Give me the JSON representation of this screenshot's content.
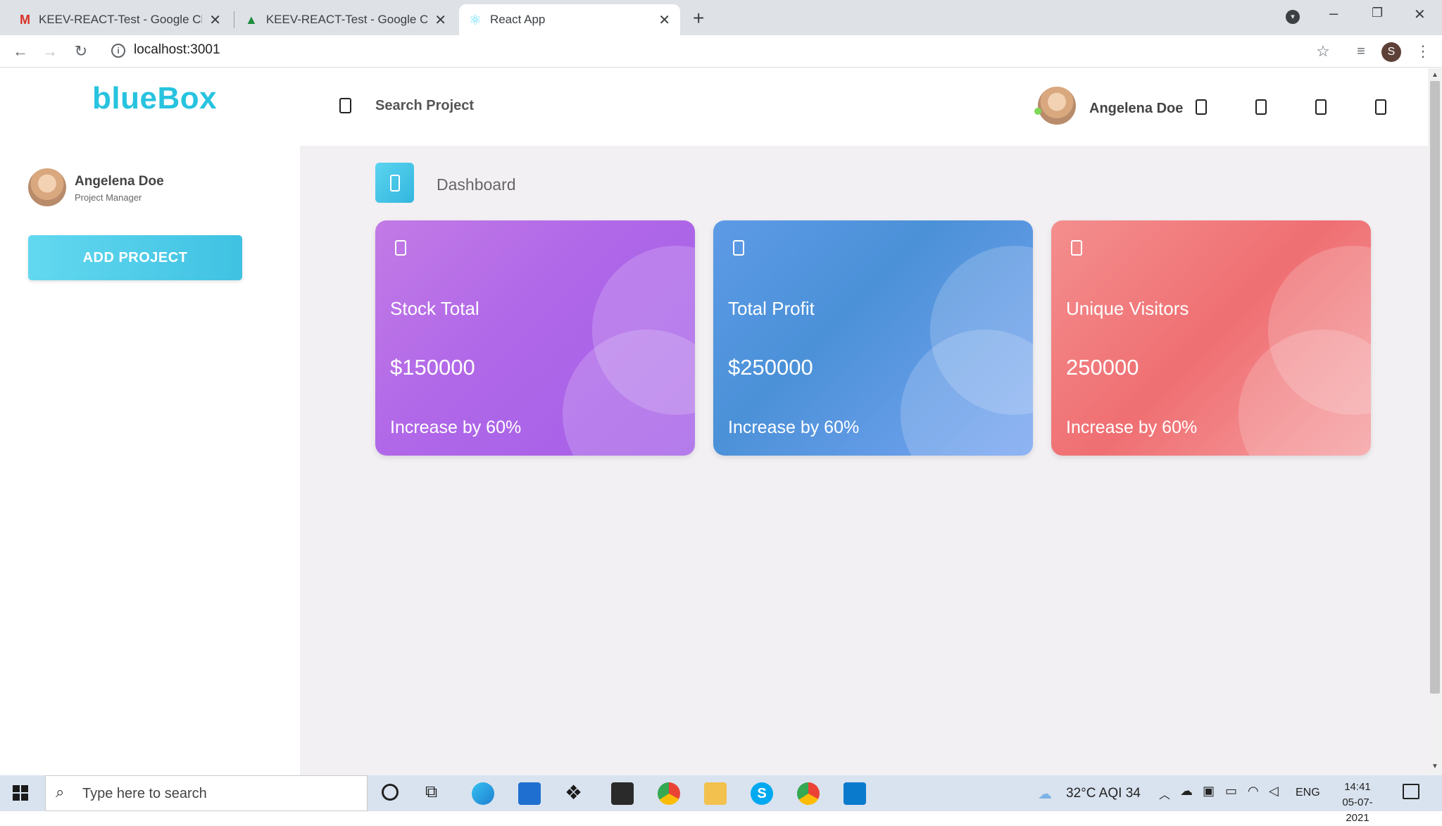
{
  "browser": {
    "tabs": [
      {
        "title": "KEEV-REACT-Test - Google Chrome",
        "icon": "gmail-icon"
      },
      {
        "title": "KEEV-REACT-Test - Google Chrome",
        "icon": "drive-icon"
      },
      {
        "title": "React App",
        "icon": "react-icon"
      }
    ],
    "url": "localhost:3001",
    "profile_initial": "S"
  },
  "header": {
    "logo": "blueBox",
    "search_label": "Search Project",
    "user_name": "Angelena Doe"
  },
  "sidebar": {
    "user_name": "Angelena Doe",
    "user_role": "Project Manager",
    "add_project_label": "ADD PROJECT"
  },
  "main": {
    "title": "Dashboard",
    "cards": [
      {
        "title": "Stock Total",
        "value": "$150000",
        "subtitle": "Increase by 60%",
        "color": "#b067e8"
      },
      {
        "title": "Total Profit",
        "value": "$250000",
        "subtitle": "Increase by 60%",
        "color": "#4b91d8"
      },
      {
        "title": "Unique Visitors",
        "value": "250000",
        "subtitle": "Increase by 60%",
        "color": "#ef6f72"
      }
    ]
  },
  "taskbar": {
    "search_placeholder": "Type here to search",
    "weather": "32°C  AQI 34",
    "language": "ENG",
    "time": "14:41",
    "date": "05-07-2021"
  },
  "colors": {
    "brand": "#27c3df",
    "main_bg": "#f2f0f3"
  }
}
